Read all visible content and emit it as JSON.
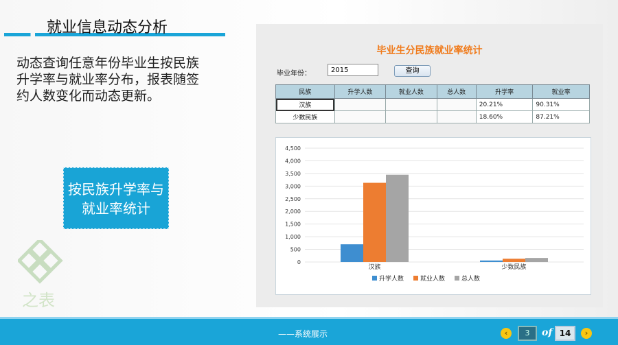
{
  "slide": {
    "title": "就业信息动态分析",
    "description": "动态查询任意年份毕业生按民族升学率与就业率分布，报表随签约人数变化而动态更新。",
    "feature_button": "按民族升学率与就业率统计",
    "logo_text": "之表"
  },
  "panel": {
    "title": "毕业生分民族就业率统计",
    "year_label": "毕业年份：",
    "year_value": "2015",
    "query_label": "查询",
    "columns": [
      "民族",
      "升学人数",
      "就业人数",
      "总人数",
      "升学率",
      "就业率"
    ],
    "rows": [
      {
        "name": "汉族",
        "admit": "",
        "employ": "",
        "total": "",
        "admit_rate": "20.21%",
        "employ_rate": "90.31%"
      },
      {
        "name": "少数民族",
        "admit": "",
        "employ": "",
        "total": "",
        "admit_rate": "18.60%",
        "employ_rate": "87.21%"
      }
    ]
  },
  "chart_data": {
    "type": "bar",
    "categories": [
      "汉族",
      "少数民族"
    ],
    "series": [
      {
        "name": "升学人数",
        "color": "#3e8ed0",
        "values": [
          700,
          60
        ]
      },
      {
        "name": "就业人数",
        "color": "#ed7d31",
        "values": [
          3130,
          130
        ]
      },
      {
        "name": "总人数",
        "color": "#a5a5a5",
        "values": [
          3450,
          160
        ]
      }
    ],
    "ylim": [
      0,
      4500
    ],
    "yticks": [
      "0",
      "500",
      "1,000",
      "1,500",
      "2,000",
      "2,500",
      "3,000",
      "3,500",
      "4,000",
      "4,500"
    ],
    "grid": true,
    "legend": "bottom"
  },
  "footer": {
    "text": "——系统展示",
    "current_page": "3",
    "of_label": "of",
    "total_pages": "14",
    "prev_icon": "‹",
    "next_icon": "›"
  }
}
